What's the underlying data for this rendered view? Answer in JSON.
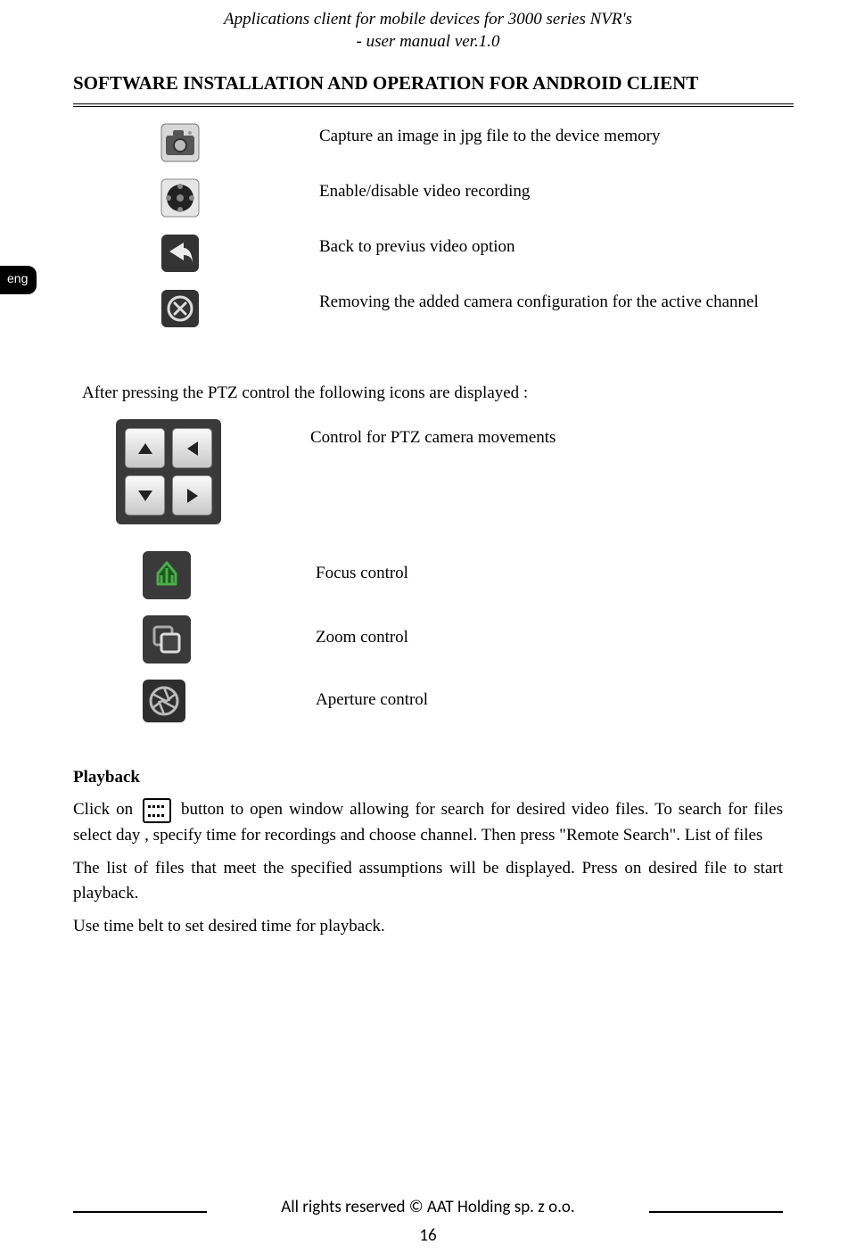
{
  "header": {
    "line1": "Applications client for mobile devices for 3000 series NVR's",
    "line2": "- user manual ver.1.0"
  },
  "section_title": "SOFTWARE INSTALLATION AND OPERATION FOR ANDROID CLIENT",
  "lang_tab": "eng",
  "icons_top": [
    {
      "label": "camera-icon",
      "desc": "Capture an image in jpg file to the device memory"
    },
    {
      "label": "record-icon",
      "desc": "Enable/disable video recording"
    },
    {
      "label": "back-icon",
      "desc": "Back to previus video option"
    },
    {
      "label": "remove-icon",
      "desc": "Removing the added camera configuration for the active channel"
    }
  ],
  "ptz_intro": "After pressing the PTZ control the following icons are displayed :",
  "ptz_items": [
    {
      "label": "ptz-pad-icon",
      "desc": "Control for PTZ camera movements"
    },
    {
      "label": "focus-icon",
      "desc": "Focus control"
    },
    {
      "label": "zoom-icon",
      "desc": "Zoom control"
    },
    {
      "label": "aperture-icon",
      "desc": "Aperture control"
    }
  ],
  "playback": {
    "title": "Playback",
    "p1a": "Click on ",
    "p1b": " button to open window allowing for search for desired video files. To search for files select day , specify time for recordings and choose channel. Then press \"Remote Search\". List of files",
    "p2": "The list of files that meet the specified assumptions will be displayed. Press on desired file to start playback.",
    "p3": "Use time belt to set desired time for playback."
  },
  "footer": "All rights reserved © AAT Holding sp. z o.o.",
  "page_number": "16"
}
